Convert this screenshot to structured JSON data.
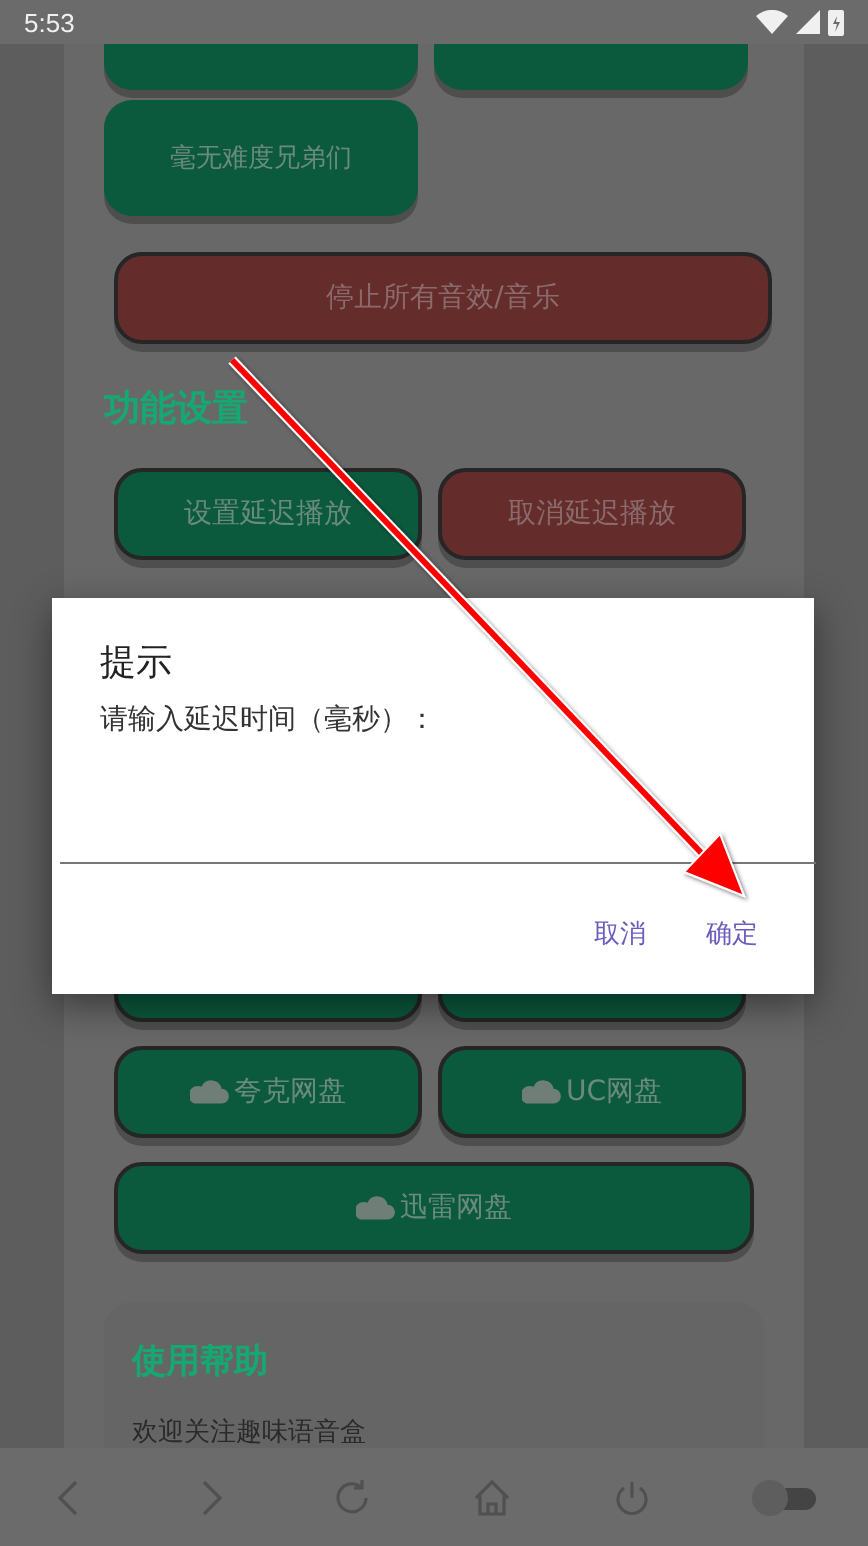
{
  "status_bar": {
    "time": "5:53"
  },
  "cut_buttons": [
    {
      "color": "#0b5a3e"
    },
    {
      "color": "#0b5a3e"
    }
  ],
  "sound_buttons": [
    {
      "label": "毫无难度兄弟们",
      "color": "#0b5a3e"
    }
  ],
  "stop_button": {
    "label": "停止所有音效/音乐",
    "color": "#652c2c"
  },
  "settings": {
    "heading": "功能设置",
    "buttons": [
      {
        "label": "设置延迟播放",
        "color": "#0b5a3e"
      },
      {
        "label": "取消延迟播放",
        "color": "#652c2c"
      }
    ]
  },
  "covered_buttons": [
    {
      "color": "#0b5a3e"
    },
    {
      "color": "#0b5a3e"
    }
  ],
  "cloud_buttons": [
    {
      "label": "夸克网盘"
    },
    {
      "label": "UC网盘"
    },
    {
      "label": "迅雷网盘"
    }
  ],
  "help": {
    "heading": "使用帮助",
    "text": "欢迎关注趣味语音盒"
  },
  "dialog": {
    "title": "提示",
    "message": "请输入延迟时间（毫秒）：",
    "buttons": [
      "取消",
      "确定"
    ]
  },
  "nav_bar": {
    "toggle": {
      "on": false
    }
  }
}
